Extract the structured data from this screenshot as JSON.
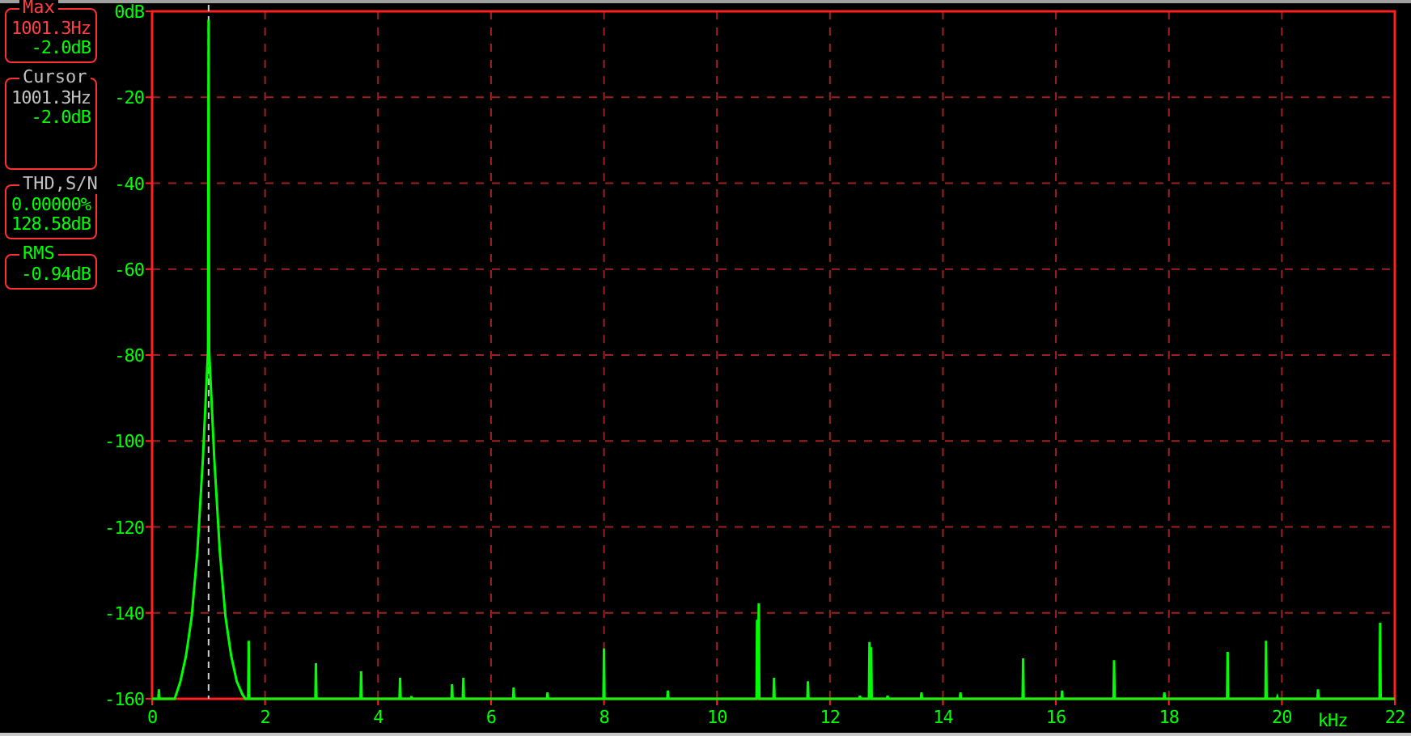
{
  "readouts": [
    {
      "title": {
        "text": "Max",
        "color": "#ff4040"
      },
      "lines": [
        {
          "text": "1001.3Hz",
          "color": "#ff4040"
        },
        {
          "text": "-2.0dB",
          "color": "#00ff00"
        }
      ]
    },
    {
      "title": {
        "text": "Cursor",
        "color": "#c0c0c0"
      },
      "lines": [
        {
          "text": "1001.3Hz",
          "color": "#c0c0c0"
        },
        {
          "text": "-2.0dB",
          "color": "#00ff00"
        }
      ],
      "tall": true
    },
    {
      "title": {
        "text": "THD,S/N",
        "color": "#c0c0c0"
      },
      "lines": [
        {
          "text": "0.00000%",
          "color": "#00ff00"
        },
        {
          "text": "128.58dB",
          "color": "#00ff00"
        }
      ]
    },
    {
      "title": {
        "text": "RMS",
        "color": "#00ff00"
      },
      "lines": [
        {
          "text": "-0.94dB",
          "color": "#00ff00"
        }
      ]
    }
  ],
  "spectrum": {
    "chart_data": {
      "type": "line",
      "xlabel": "kHz",
      "x": [
        0,
        0.11,
        0.12,
        0.13,
        0.4,
        0.5,
        0.6,
        0.7,
        0.8,
        0.9,
        0.95,
        0.99,
        1.0,
        1.01,
        1.05,
        1.1,
        1.2,
        1.3,
        1.4,
        1.5,
        1.6,
        1.65,
        1.7,
        1.71,
        1.72,
        2.89,
        2.9,
        2.91,
        3.69,
        3.7,
        3.71,
        4.38,
        4.39,
        4.4,
        4.58,
        4.59,
        4.6,
        5.3,
        5.31,
        5.32,
        5.5,
        5.51,
        5.52,
        6.39,
        6.4,
        6.41,
        6.99,
        7.0,
        7.01,
        7.99,
        8.0,
        8.01,
        9.12,
        9.13,
        9.14,
        10.7,
        10.71,
        10.72,
        10.74,
        10.75,
        11.0,
        11.01,
        11.02,
        11.6,
        11.61,
        11.62,
        12.52,
        12.53,
        12.54,
        12.69,
        12.7,
        12.72,
        12.73,
        12.74,
        13.01,
        13.02,
        13.03,
        13.61,
        13.62,
        13.63,
        14.3,
        14.31,
        14.32,
        15.41,
        15.42,
        15.43,
        16.1,
        16.11,
        16.12,
        17.02,
        17.03,
        17.04,
        17.91,
        17.92,
        17.93,
        19.03,
        19.04,
        19.05,
        19.71,
        19.72,
        19.73,
        19.91,
        19.92,
        19.93,
        20.63,
        20.64,
        20.65,
        21.73,
        21.74,
        21.75,
        22
      ],
      "series": [
        {
          "color": "#00ff00",
          "values": [
            -160,
            -160,
            -157.8,
            -160,
            -160,
            -156,
            -150,
            -141,
            -126,
            -104,
            -90,
            -79,
            -2,
            -79,
            -90,
            -104,
            -126,
            -141,
            -150,
            -156,
            -159,
            -160,
            -160,
            -146.5,
            -160,
            -160,
            -151.7,
            -160,
            -160,
            -153.6,
            -160,
            -160,
            -155.1,
            -160,
            -160,
            -159.4,
            -160,
            -160,
            -156.6,
            -160,
            -160,
            -155.1,
            -160,
            -160,
            -157.4,
            -160,
            -160,
            -158.5,
            -160,
            -160,
            -148.3,
            -160,
            -160,
            -158.1,
            -160,
            -160,
            -141.6,
            -160,
            -137.8,
            -160,
            -160,
            -155.1,
            -160,
            -160,
            -155.9,
            -160,
            -160,
            -159.3,
            -160,
            -160,
            -146.8,
            -160,
            -148,
            -160,
            -160,
            -159.3,
            -160,
            -160,
            -158.5,
            -160,
            -160,
            -158.5,
            -160,
            -160,
            -150.6,
            -160,
            -160,
            -158.1,
            -160,
            -160,
            -151,
            -160,
            -160,
            -158.5,
            -160,
            -160,
            -149.1,
            -160,
            -160,
            -146.5,
            -160,
            -160,
            -159.6,
            -160,
            -160,
            -157.8,
            -160,
            -160,
            -142.3,
            -160,
            -160
          ]
        }
      ],
      "xlim": [
        0,
        22
      ],
      "ylim": [
        -160,
        0
      ],
      "grid": true,
      "xticks": [
        0,
        2,
        4,
        6,
        8,
        10,
        12,
        14,
        16,
        18,
        20,
        22
      ],
      "yticks": [
        {
          "value": 0,
          "label": "0dB"
        },
        -20,
        -40,
        -60,
        -80,
        -100,
        -120,
        -140,
        -160
      ],
      "ref_lines": [
        {
          "axis": "x",
          "value": 1.0,
          "color": "#d0d0d0"
        }
      ]
    }
  }
}
